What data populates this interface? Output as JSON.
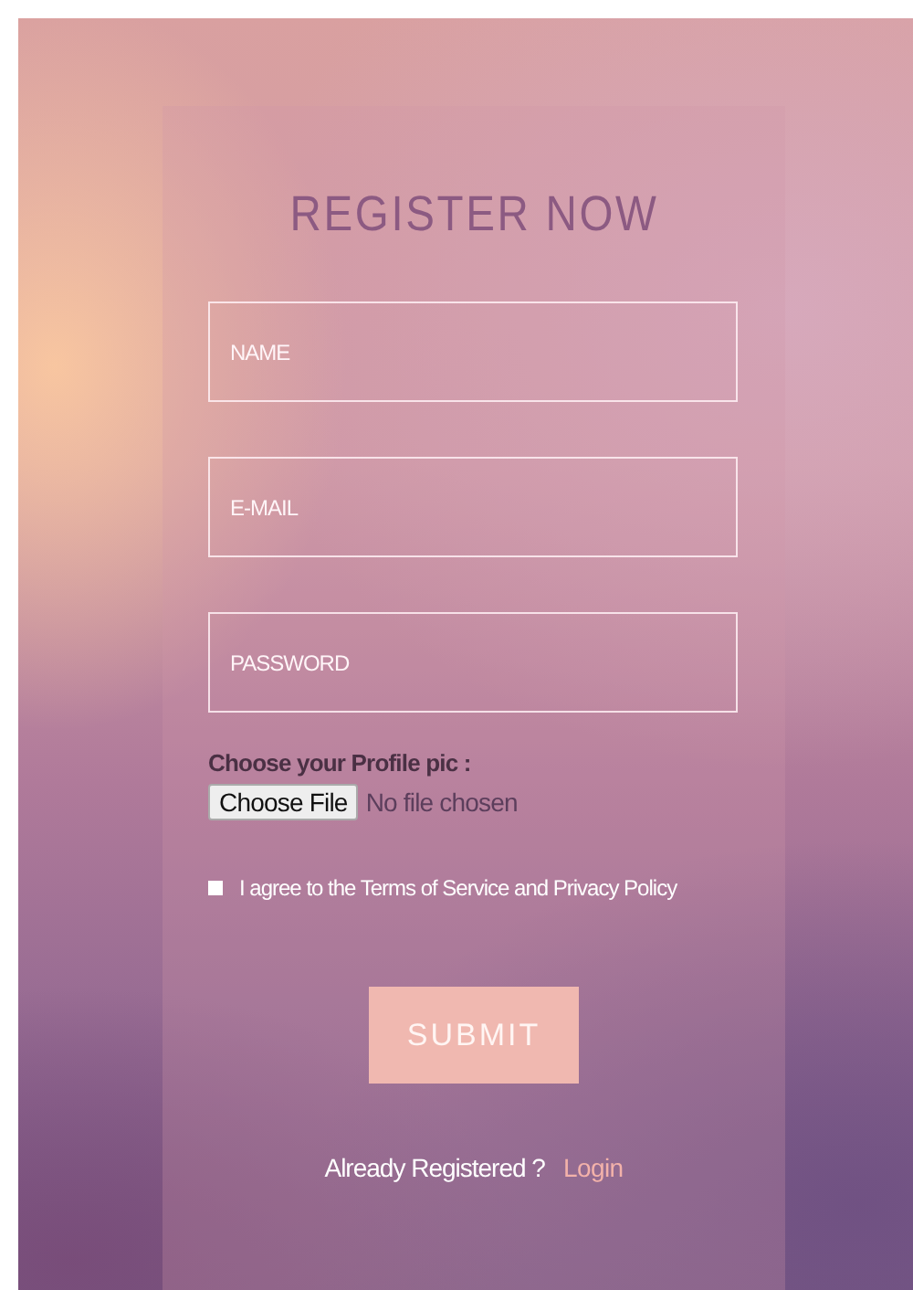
{
  "form": {
    "title": "REGISTER NOW",
    "fields": [
      {
        "placeholder": "NAME"
      },
      {
        "placeholder": "E-MAIL"
      },
      {
        "placeholder": "PASSWORD"
      }
    ],
    "file_label": "Choose your Profile pic :",
    "file_button": "Choose File",
    "file_status": "No file chosen",
    "agree": {
      "label": "I agree to the Terms of Service and Privacy Policy",
      "checked": false
    },
    "submit": "SUBMIT",
    "footer_text": "Already Registered ?",
    "footer_link": "Login"
  }
}
